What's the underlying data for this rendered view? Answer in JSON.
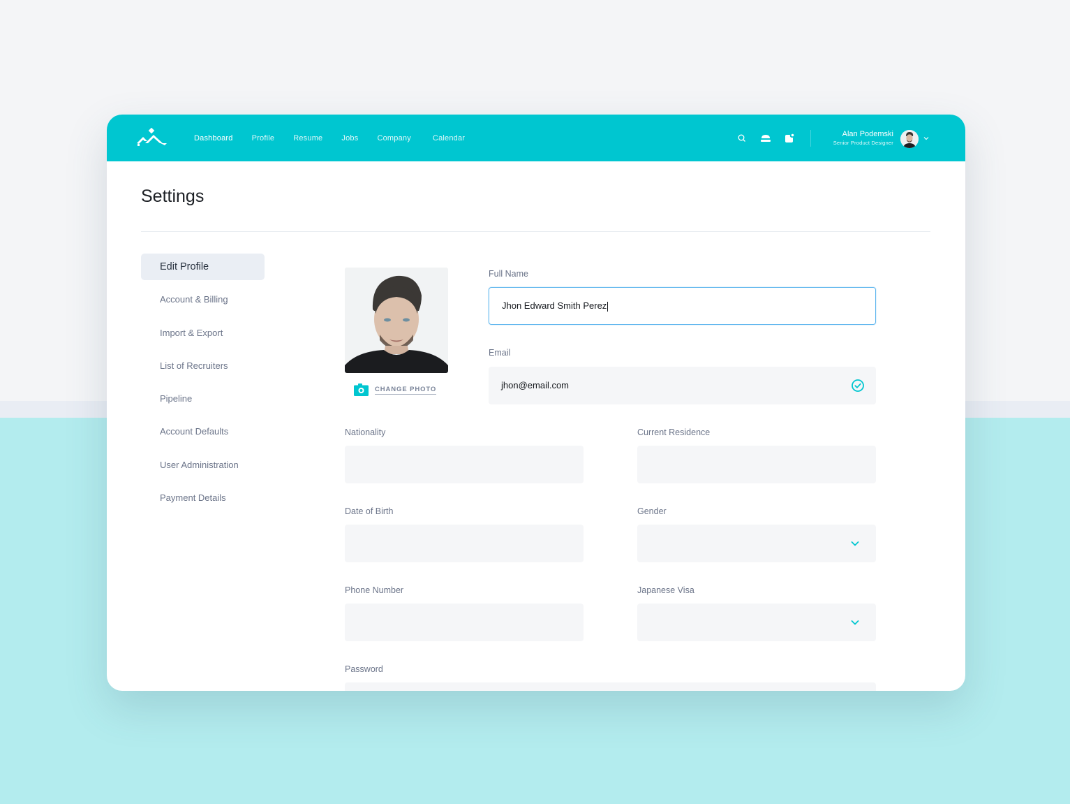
{
  "colors": {
    "brand": "#00c6d0",
    "focus_border": "#5fb6ee",
    "field_bg": "#f5f6f8",
    "label": "#6b7489",
    "sidebar_active_bg": "#eaeef4",
    "bg_bottom": "#b3ecee"
  },
  "topbar": {
    "logo_icon": "mountain-logo-icon",
    "nav": [
      {
        "label": "Dashboard",
        "active": true
      },
      {
        "label": "Profile",
        "active": false
      },
      {
        "label": "Resume",
        "active": false
      },
      {
        "label": "Jobs",
        "active": false
      },
      {
        "label": "Company",
        "active": false
      },
      {
        "label": "Calendar",
        "active": false
      }
    ],
    "icons": [
      "search-icon",
      "inbox-icon",
      "notification-icon"
    ],
    "user": {
      "name": "Alan Podemski",
      "role": "Senior Product Designer",
      "menu_icon": "chevron-down-icon"
    }
  },
  "page": {
    "title": "Settings"
  },
  "sidebar": {
    "items": [
      {
        "label": "Edit Profile",
        "active": true
      },
      {
        "label": "Account & Billing",
        "active": false
      },
      {
        "label": "Import & Export",
        "active": false
      },
      {
        "label": "List of Recruiters",
        "active": false
      },
      {
        "label": "Pipeline",
        "active": false
      },
      {
        "label": "Account Defaults",
        "active": false
      },
      {
        "label": "User Administration",
        "active": false
      },
      {
        "label": "Payment Details",
        "active": false
      }
    ]
  },
  "profile": {
    "change_photo_label": "CHANGE PHOTO",
    "fields": {
      "full_name": {
        "label": "Full Name",
        "value": "Jhon Edward Smith Perez"
      },
      "email": {
        "label": "Email",
        "value": "jhon@email.com",
        "status_icon": "check-circle-icon",
        "verified": true
      },
      "nationality": {
        "label": "Nationality",
        "value": ""
      },
      "current_residence": {
        "label": "Current Residence",
        "value": ""
      },
      "date_of_birth": {
        "label": "Date of Birth",
        "value": ""
      },
      "gender": {
        "label": "Gender",
        "value": "",
        "type": "select"
      },
      "phone_number": {
        "label": "Phone Number",
        "value": ""
      },
      "japanese_visa": {
        "label": "Japanese Visa",
        "value": "",
        "type": "select"
      },
      "password": {
        "label": "Password",
        "value": ""
      }
    }
  }
}
